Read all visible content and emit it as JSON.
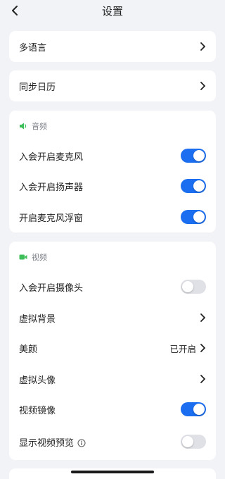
{
  "header": {
    "title": "设置"
  },
  "general": {
    "language_label": "多语言",
    "calendar_label": "同步日历"
  },
  "audio": {
    "section_label": "音频",
    "items": [
      {
        "label": "入会开启麦克风",
        "enabled": true
      },
      {
        "label": "入会开启扬声器",
        "enabled": true
      },
      {
        "label": "开启麦克风浮窗",
        "enabled": true
      }
    ]
  },
  "video": {
    "section_label": "视频",
    "camera": {
      "label": "入会开启摄像头",
      "enabled": false
    },
    "virtual_background": {
      "label": "虚拟背景"
    },
    "beauty": {
      "label": "美颜",
      "value": "已开启"
    },
    "virtual_avatar": {
      "label": "虚拟头像"
    },
    "mirror": {
      "label": "视频镜像",
      "enabled": true
    },
    "preview": {
      "label": "显示视频预览",
      "enabled": false
    }
  },
  "colors": {
    "accent": "#1b6ef0",
    "section_icon": "#3fbf5a",
    "background": "#f2f3f7"
  }
}
